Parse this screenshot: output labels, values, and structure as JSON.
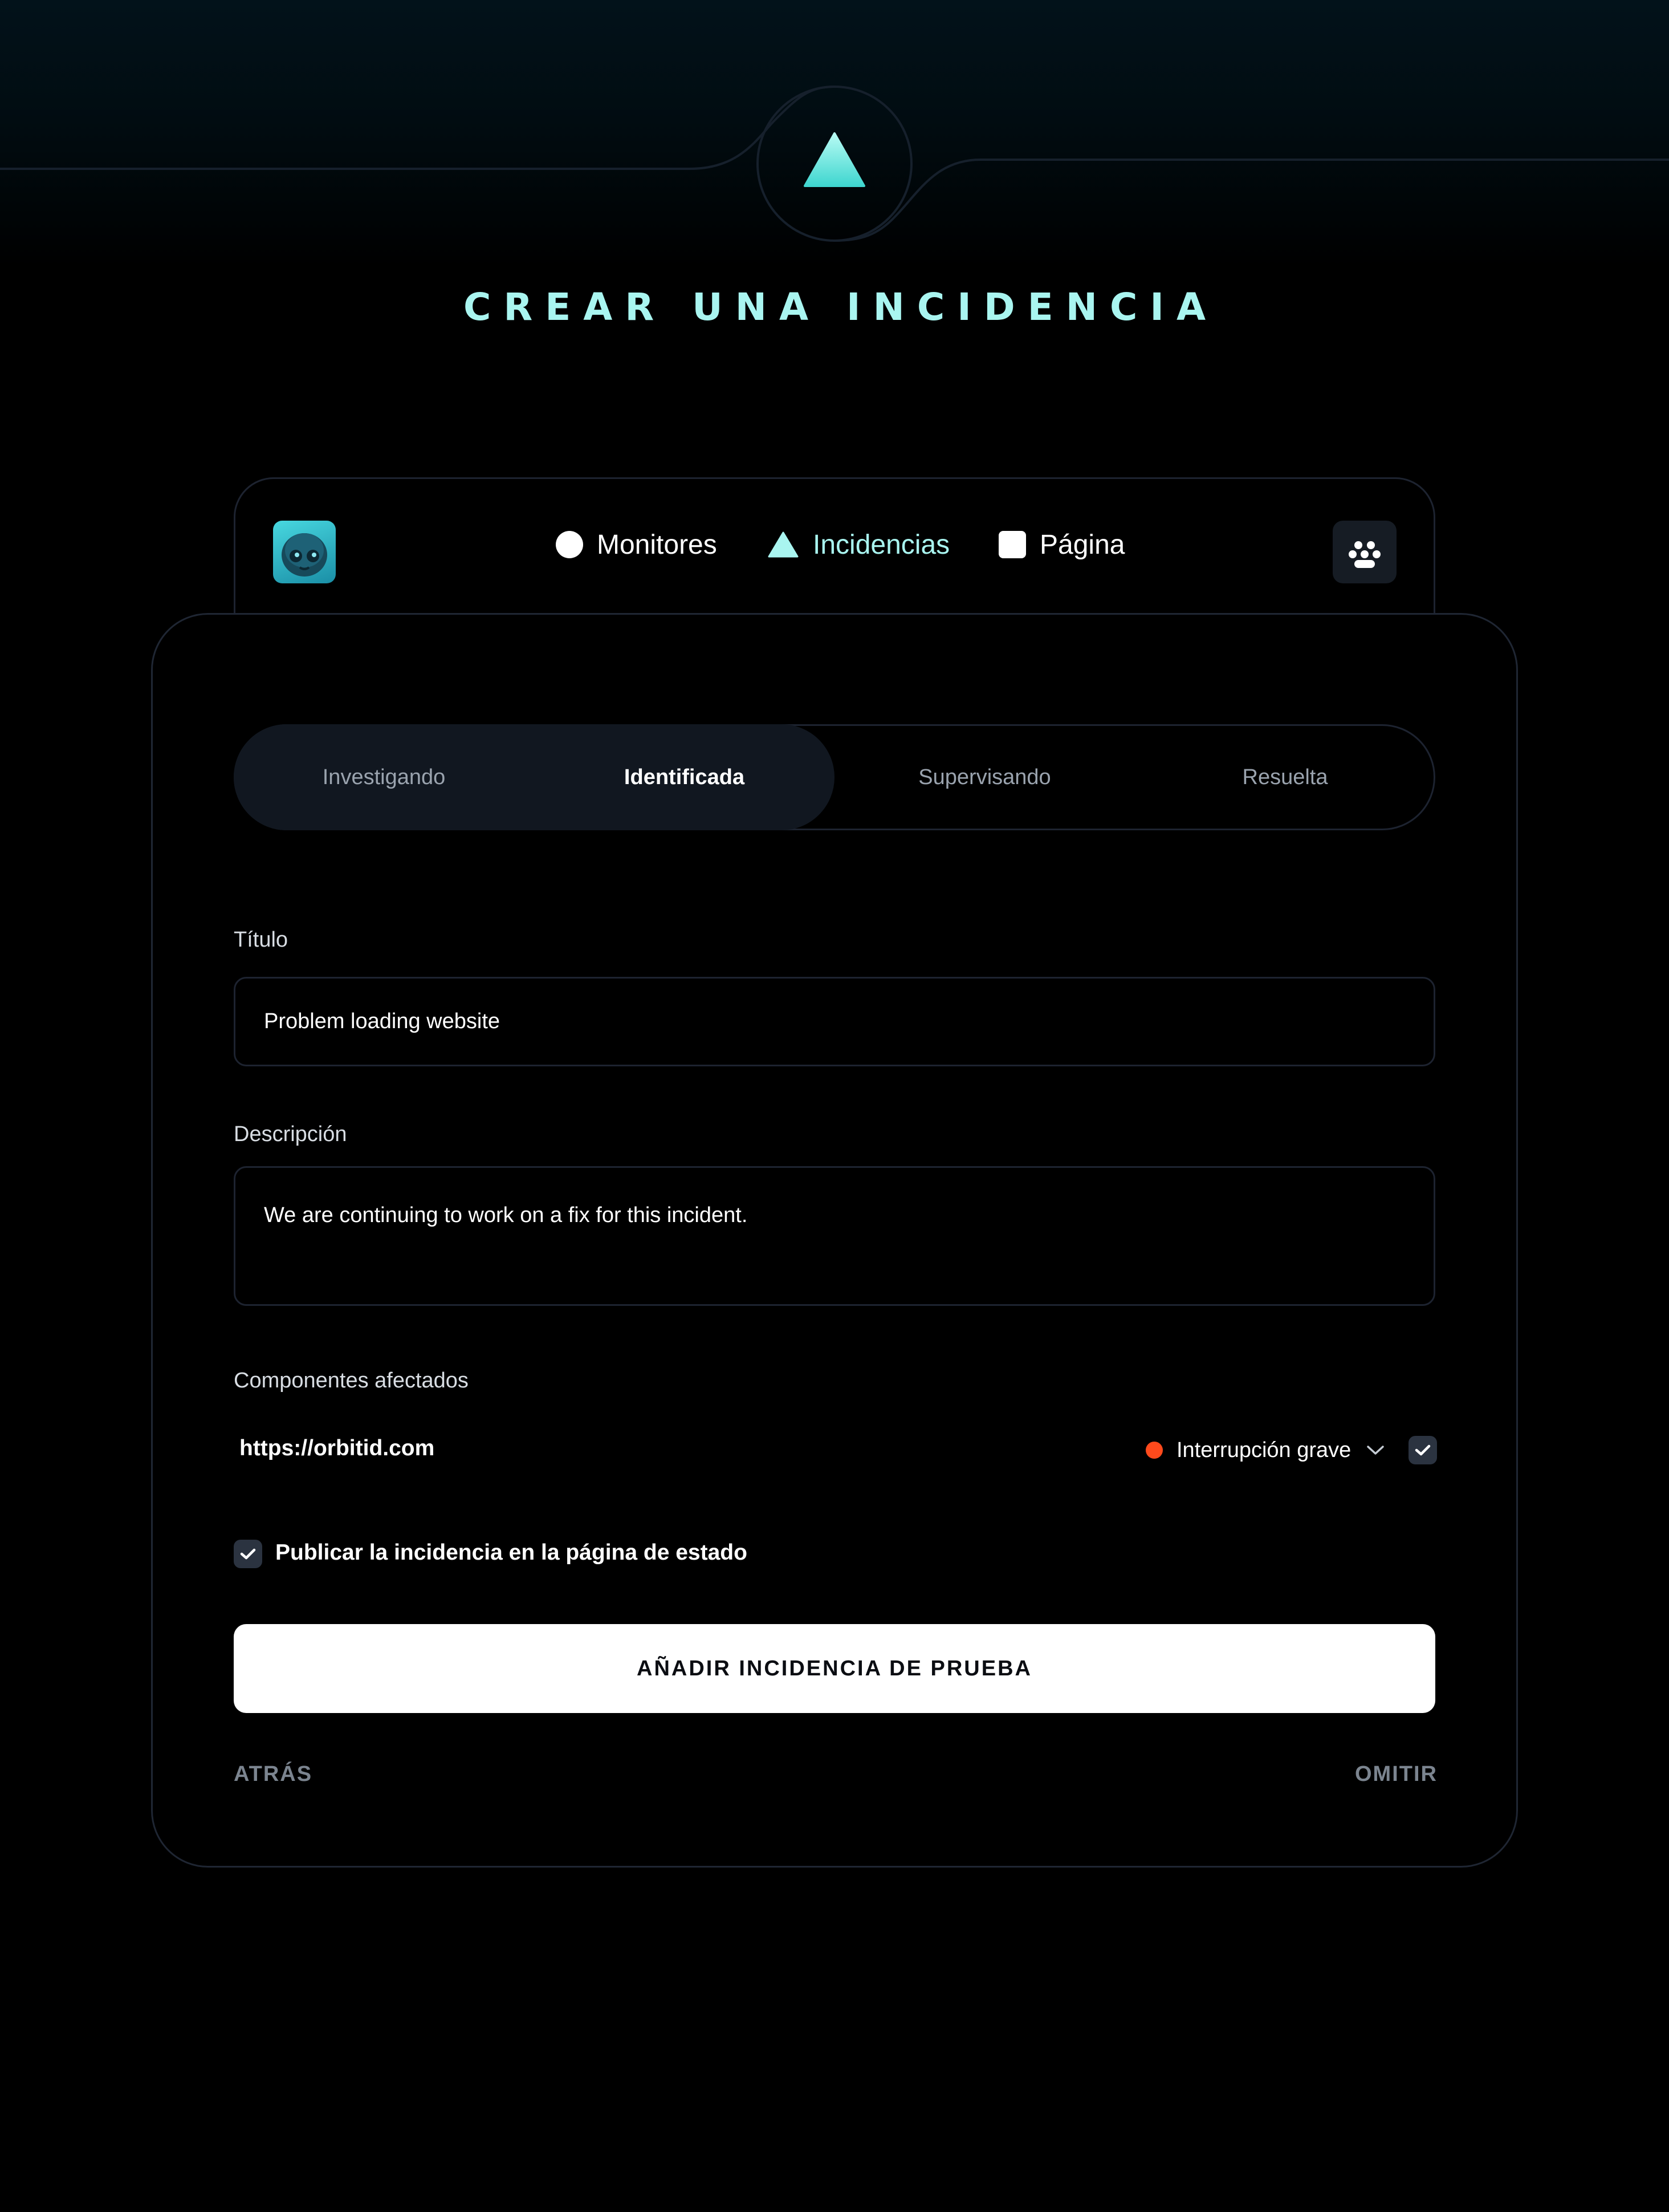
{
  "page": {
    "title": "CREAR UNA INCIDENCIA"
  },
  "nav": {
    "tabs": [
      {
        "label": "Monitores",
        "icon": "circle-icon",
        "active": false
      },
      {
        "label": "Incidencias",
        "icon": "triangle-icon",
        "active": true
      },
      {
        "label": "Página",
        "icon": "square-icon",
        "active": false
      }
    ]
  },
  "status_steps": {
    "items": [
      "Investigando",
      "Identificada",
      "Supervisando",
      "Resuelta"
    ],
    "selected": "Identificada"
  },
  "form": {
    "title_label": "Título",
    "title_value": "Problem loading website",
    "description_label": "Descripción",
    "description_value": "We are continuing to work on a fix for this incident.",
    "components_label": "Componentes afectados",
    "component": {
      "url": "https://orbitid.com",
      "status": "Interrupción grave",
      "status_color": "#ff4a1c",
      "checked": true
    },
    "publish_label": "Publicar la incidencia en la página de estado",
    "publish_checked": true,
    "submit_label": "AÑADIR INCIDENCIA DE PRUEBA",
    "back_label": "ATRÁS",
    "skip_label": "OMITIR"
  },
  "colors": {
    "accent": "#a9f5f0",
    "background": "#000000",
    "border": "#1d2330",
    "danger": "#ff4a1c"
  }
}
